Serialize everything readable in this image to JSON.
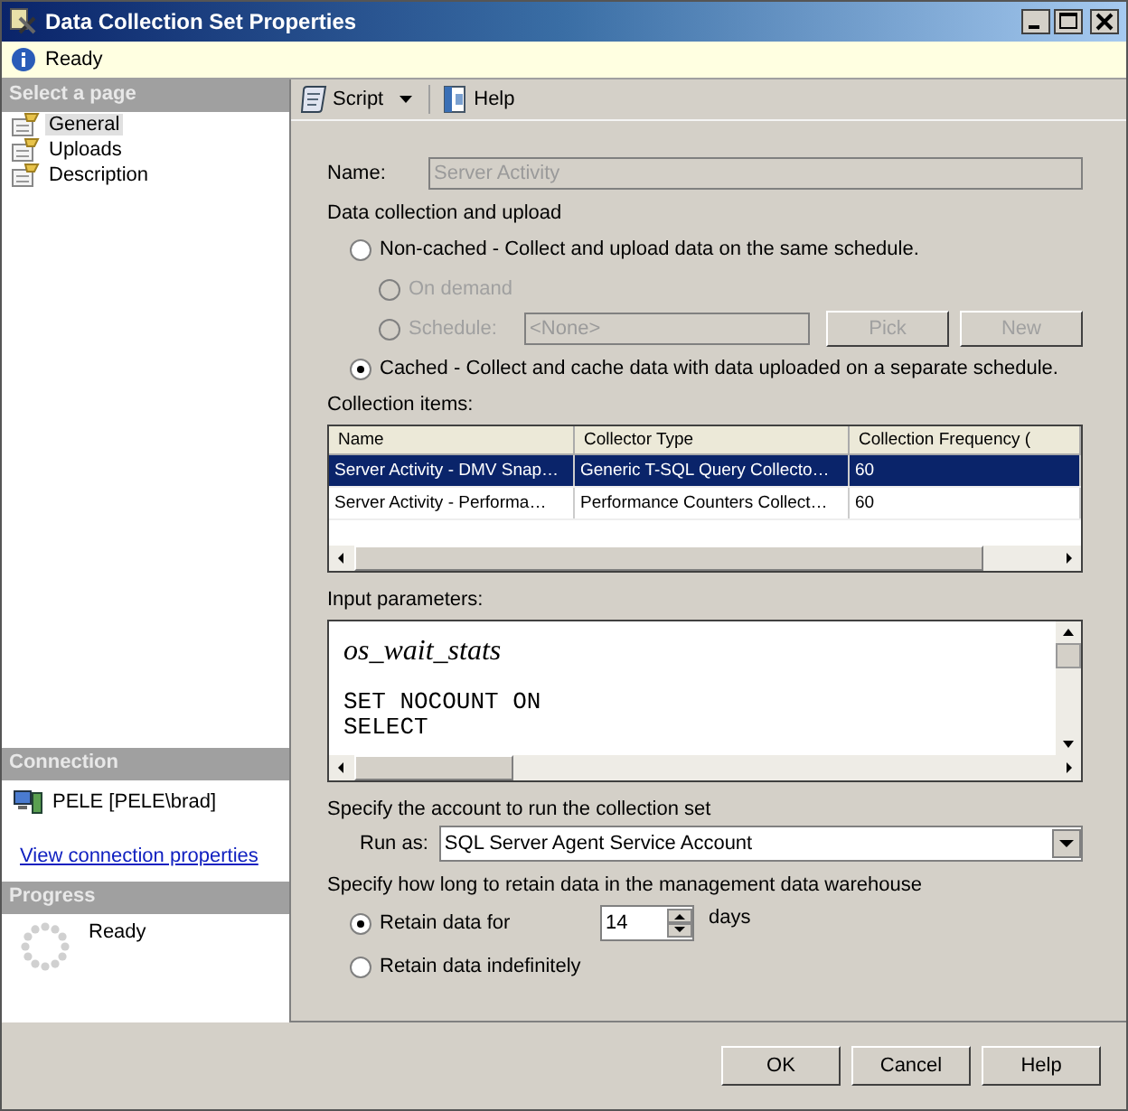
{
  "window": {
    "title": "Data Collection Set Properties"
  },
  "status": {
    "text": "Ready"
  },
  "sidebar": {
    "header": "Select a page",
    "pages": [
      {
        "label": "General",
        "selected": true
      },
      {
        "label": "Uploads",
        "selected": false
      },
      {
        "label": "Description",
        "selected": false
      }
    ]
  },
  "connection": {
    "header": "Connection",
    "server": "PELE [PELE\\brad]",
    "link": "View connection properties"
  },
  "progress": {
    "header": "Progress",
    "status": "Ready"
  },
  "toolbar": [
    {
      "label": "Script",
      "kind": "script"
    },
    {
      "label": "Help",
      "kind": "help"
    }
  ],
  "form": {
    "name_label": "Name:",
    "name_value": "Server Activity",
    "upload_label": "Data collection and upload",
    "non_cached": {
      "label": "Non-cached - Collect and upload data on the same schedule.",
      "selected": false
    },
    "sub_options": [
      {
        "label": "On demand",
        "selected": false,
        "disabled": true,
        "kind": "plain"
      },
      {
        "label": "Schedule:",
        "selected": false,
        "disabled": true,
        "kind": "schedule",
        "value": "<None>",
        "buttons": [
          "Pick",
          "New"
        ]
      }
    ],
    "cached": {
      "label": "Cached - Collect and cache data with data uploaded on a separate schedule.",
      "selected": true
    }
  },
  "collection_items": {
    "label": "Collection items:",
    "columns": [
      "Name",
      "Collector Type",
      "Collection Frequency ("
    ],
    "rows": [
      {
        "cells": [
          "Server Activity - DMV Snap…",
          "Generic T-SQL Query Collecto…",
          "60"
        ],
        "selected": true
      },
      {
        "cells": [
          "Server Activity - Performa…",
          "Performance Counters Collect…",
          "60"
        ],
        "selected": false
      }
    ]
  },
  "input_parameters": {
    "label": "Input parameters:",
    "title": "os_wait_stats",
    "code": [
      "SET NOCOUNT ON",
      "SELECT"
    ]
  },
  "account": {
    "label": "Specify the account to run the collection set",
    "run_as_label": "Run as:",
    "run_as_value": "SQL Server Agent Service Account"
  },
  "retention": {
    "label": "Specify how long to retain data in the management data warehouse",
    "options": [
      {
        "label": "Retain data for",
        "selected": true,
        "kind": "days",
        "value": "14",
        "unit": "days"
      },
      {
        "label": "Retain data indefinitely",
        "selected": false,
        "kind": "plain"
      }
    ]
  },
  "buttons": [
    "OK",
    "Cancel",
    "Help"
  ]
}
